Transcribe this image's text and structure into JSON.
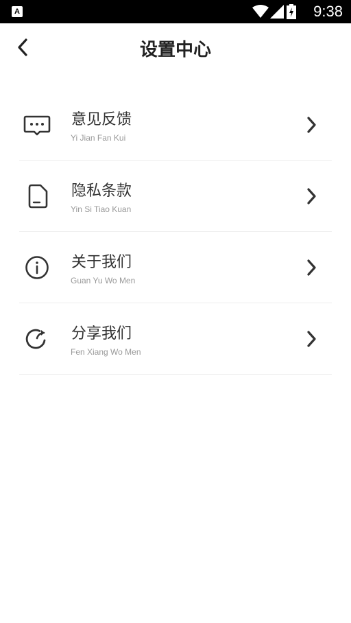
{
  "status_bar": {
    "app_icon_letter": "A",
    "time": "9:38"
  },
  "header": {
    "title": "设置中心",
    "back_icon": "chevron-left-icon"
  },
  "menu": [
    {
      "label": "意见反馈",
      "sublabel": "Yi Jian Fan Kui",
      "icon": "message-dots-icon"
    },
    {
      "label": "隐私条款",
      "sublabel": "Yin Si Tiao Kuan",
      "icon": "document-icon"
    },
    {
      "label": "关于我们",
      "sublabel": "Guan Yu Wo Men",
      "icon": "info-icon"
    },
    {
      "label": "分享我们",
      "sublabel": "Fen Xiang Wo Men",
      "icon": "share-icon"
    }
  ],
  "colors": {
    "status_bar_bg": "#000000",
    "text_primary": "#333333",
    "text_secondary": "#999999",
    "divider": "#eeeeee"
  }
}
